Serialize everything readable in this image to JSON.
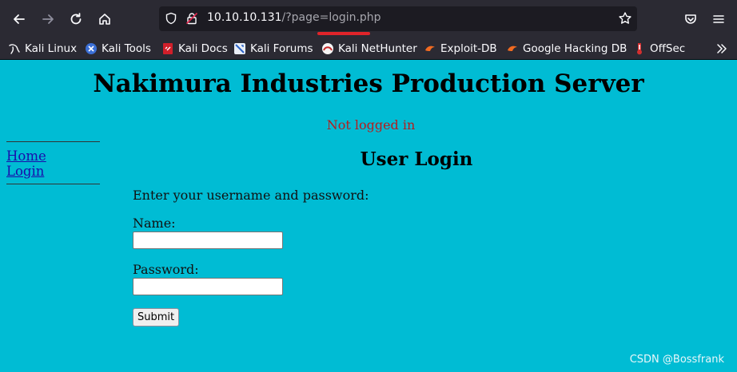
{
  "browser": {
    "url_host": "10.10.10.131",
    "url_path": "/?page=login.php",
    "bookmarks": [
      {
        "label": "Kali Linux",
        "icon": "kali-dragon-icon"
      },
      {
        "label": "Kali Tools",
        "icon": "kali-tools-icon"
      },
      {
        "label": "Kali Docs",
        "icon": "kali-docs-icon"
      },
      {
        "label": "Kali Forums",
        "icon": "kali-forums-icon"
      },
      {
        "label": "Kali NetHunter",
        "icon": "nethunter-icon"
      },
      {
        "label": "Exploit-DB",
        "icon": "exploit-db-icon"
      },
      {
        "label": "Google Hacking DB",
        "icon": "ghdb-icon"
      },
      {
        "label": "OffSec",
        "icon": "offsec-icon"
      }
    ]
  },
  "page": {
    "title": "Nakimura Industries Production Server",
    "status": "Not logged in",
    "nav": [
      {
        "label": "Home"
      },
      {
        "label": "Login"
      }
    ],
    "heading": "User Login",
    "instructions": "Enter your username and password:",
    "name_label": "Name:",
    "password_label": "Password:",
    "submit_label": "Submit"
  },
  "watermark": "CSDN @Bossfrank",
  "colors": {
    "page_background": "#00bcd4",
    "status_text": "#b71c1c",
    "link": "#1a0dab",
    "browser_chrome": "#2b2a33"
  }
}
